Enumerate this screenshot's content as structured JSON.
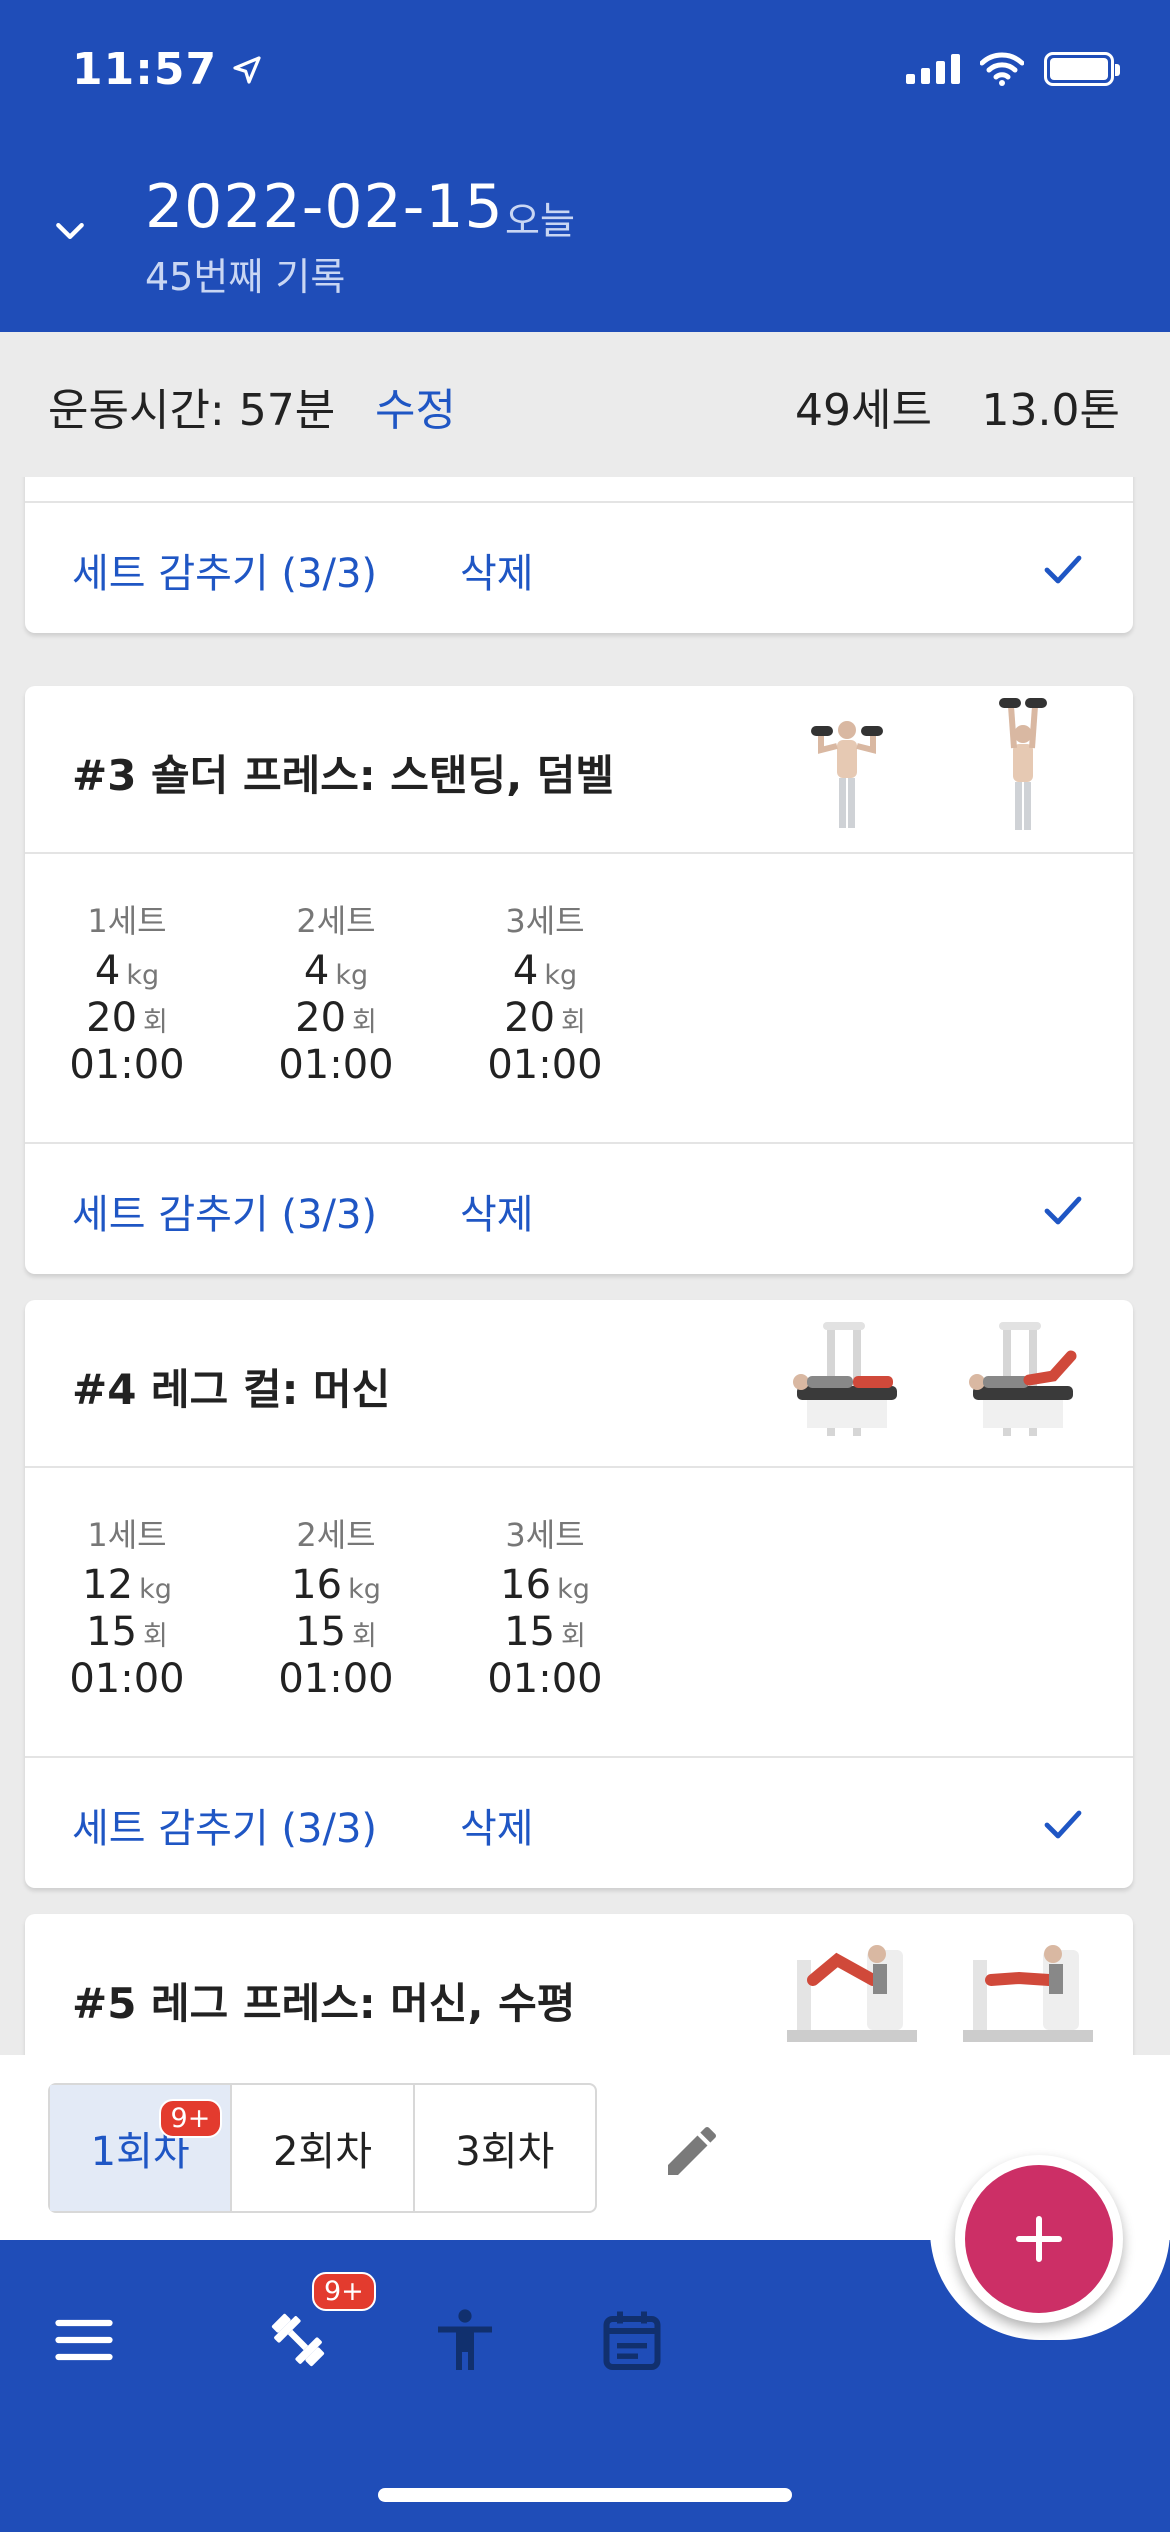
{
  "status_bar": {
    "time": "11:57"
  },
  "header": {
    "date": "2022-02-15",
    "today": "오늘",
    "record_count": "45번째 기록"
  },
  "summary": {
    "workout_time": "운동시간: 57분",
    "edit": "수정",
    "sets": "49세트",
    "tons": "13.0톤"
  },
  "exercises": [
    {
      "title": "",
      "hide_sets": "세트 감추기 (3/3)",
      "delete": "삭제"
    },
    {
      "title": "#3 숄더 프레스: 스탠딩, 덤벨",
      "hide_sets": "세트 감추기 (3/3)",
      "delete": "삭제",
      "sets": [
        {
          "label": "1세트",
          "weight": "4",
          "weight_unit": "kg",
          "reps": "20",
          "reps_unit": "회",
          "rest": "01:00"
        },
        {
          "label": "2세트",
          "weight": "4",
          "weight_unit": "kg",
          "reps": "20",
          "reps_unit": "회",
          "rest": "01:00"
        },
        {
          "label": "3세트",
          "weight": "4",
          "weight_unit": "kg",
          "reps": "20",
          "reps_unit": "회",
          "rest": "01:00"
        }
      ]
    },
    {
      "title": "#4 레그 컬: 머신",
      "hide_sets": "세트 감추기 (3/3)",
      "delete": "삭제",
      "sets": [
        {
          "label": "1세트",
          "weight": "12",
          "weight_unit": "kg",
          "reps": "15",
          "reps_unit": "회",
          "rest": "01:00"
        },
        {
          "label": "2세트",
          "weight": "16",
          "weight_unit": "kg",
          "reps": "15",
          "reps_unit": "회",
          "rest": "01:00"
        },
        {
          "label": "3세트",
          "weight": "16",
          "weight_unit": "kg",
          "reps": "15",
          "reps_unit": "회",
          "rest": "01:00"
        }
      ]
    },
    {
      "title": "#5 레그 프레스: 머신, 수평"
    }
  ],
  "round_tabs": [
    {
      "label": "1회차",
      "badge": "9+",
      "active": true
    },
    {
      "label": "2회차"
    },
    {
      "label": "3회차"
    }
  ],
  "bottom_nav": {
    "workout_badge": "9+",
    "icons": [
      "menu-icon",
      "dumbbell-icon",
      "body-icon",
      "calendar-icon"
    ]
  },
  "fab": {
    "label": "+"
  },
  "colors": {
    "primary": "#1f4db8",
    "accent": "#cc2f66",
    "link": "#1f56c4",
    "badge": "#e33b2e"
  }
}
